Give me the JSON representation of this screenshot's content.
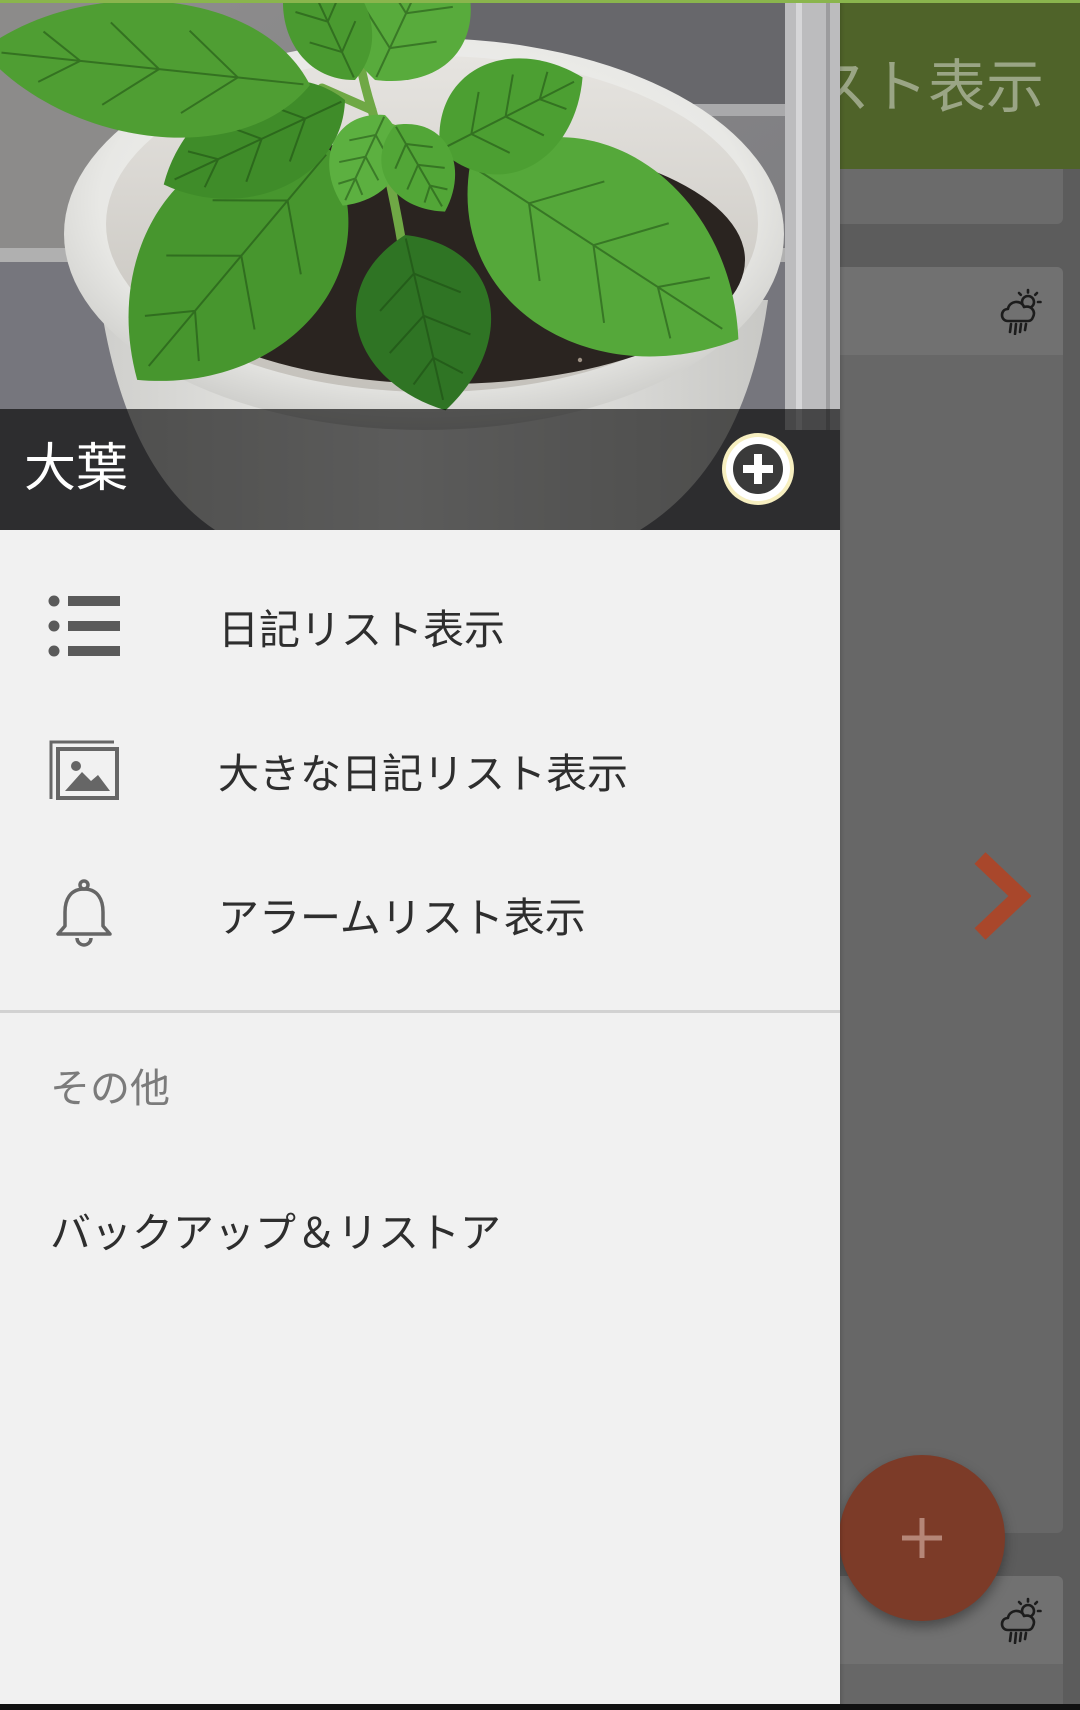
{
  "colors": {
    "toolbar_green": "#4f6329",
    "accent_line": "#8ab54d",
    "drawer_bg": "#f1f1f1",
    "chevron": "#a9472b",
    "fab": "#7c3b28",
    "screen_bg": "#5c5c5c"
  },
  "drawer": {
    "header": {
      "title": "大葉",
      "add_icon": "add-circle-icon"
    },
    "menu": [
      {
        "icon": "list-icon",
        "label": "日記リスト表示"
      },
      {
        "icon": "image-gallery-icon",
        "label": "大きな日記リスト表示"
      },
      {
        "icon": "bell-icon",
        "label": "アラームリスト表示"
      }
    ],
    "other_section": {
      "title": "その他",
      "items": [
        {
          "label": "バックアップ＆リストア"
        }
      ]
    }
  },
  "background_screen": {
    "toolbar": {
      "title": "スト表示"
    },
    "cards": [
      {
        "weather_icon": ""
      },
      {
        "weather_icon": "cloud-sun-rain-icon"
      },
      {
        "weather_icon": "cloud-sun-rain-icon"
      }
    ],
    "next_icon": "chevron-right-icon",
    "fab": {
      "icon": "plus-icon"
    }
  }
}
